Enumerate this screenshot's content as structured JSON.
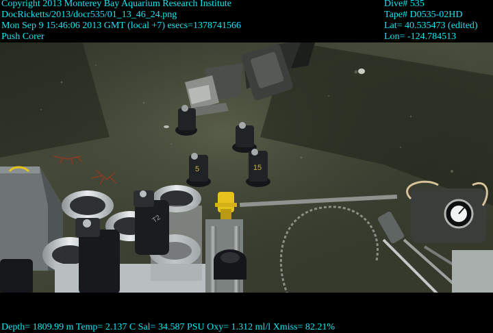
{
  "overlay": {
    "top_left": [
      "Copyright 2013 Monterey Bay Aquarium Research Institute",
      "DocRicketts/2013/docr535/01_13_46_24.png",
      "Mon Sep  9 15:46:06 2013 GMT (local +7)  esecs=1378741566",
      "Push Corer"
    ],
    "top_right": [
      "Dive# 535",
      "Tape# D0535-02HD",
      "Lat= 40.535473 (edited)",
      "Lon= -124.784513"
    ],
    "bottom": "Depth= 1809.99 m  Temp= 2.137 C  Sal= 34.587 PSU  Oxy= 1.312 ml/l  Xmiss= 82.21%"
  },
  "scene": {
    "core_labels": [
      "5",
      "15",
      "T2"
    ],
    "colors": {
      "sediment": "#3f4436",
      "sediment_dark": "#262a20",
      "overlay_text": "#12e7f2",
      "rope": "#d8c29a",
      "yellow_part": "#e6c31c"
    }
  }
}
